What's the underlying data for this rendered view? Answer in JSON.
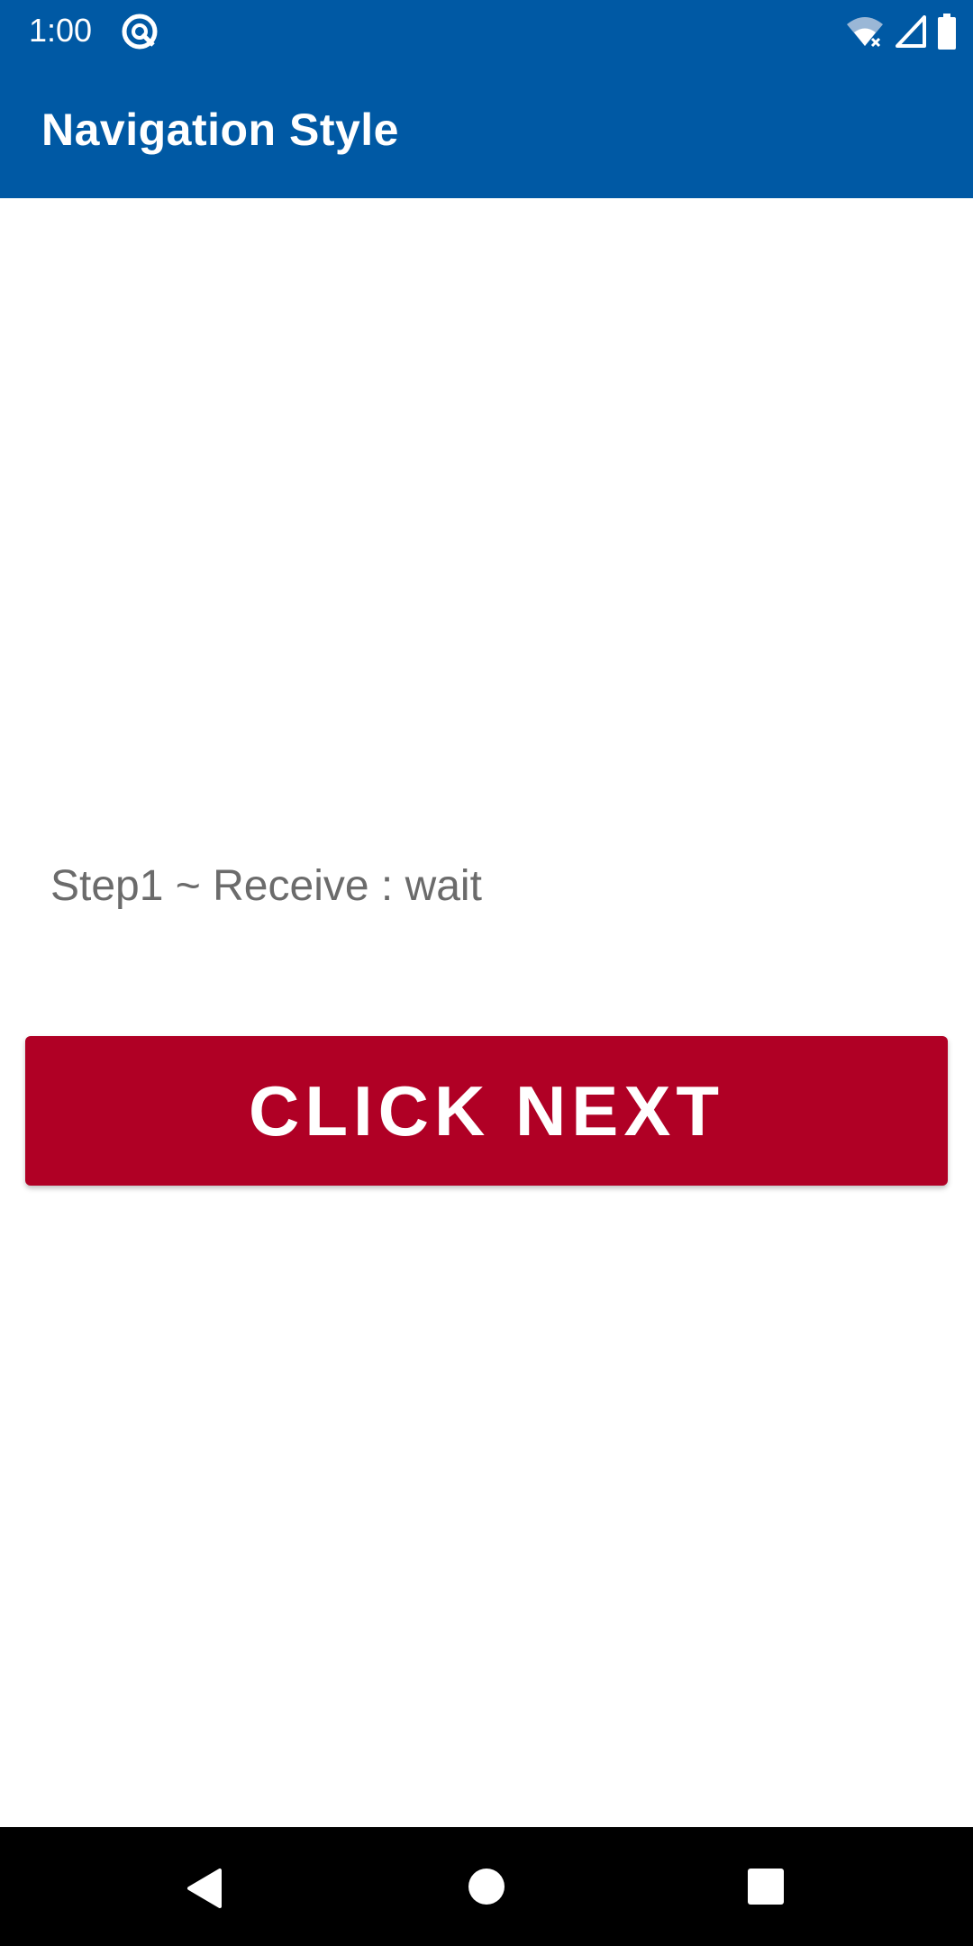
{
  "status_bar": {
    "time": "1:00",
    "icons": [
      "app-notification-icon",
      "wifi-icon",
      "cell-signal-icon",
      "battery-icon"
    ],
    "background": "#0059a4"
  },
  "app_bar": {
    "title": "Navigation Style",
    "background": "#0059a4"
  },
  "main": {
    "step_status": "Step1 ~ Receive : wait",
    "next_button_label": "CLICK NEXT",
    "next_button_color": "#b00025"
  },
  "nav_bar": {
    "buttons": [
      "back-icon",
      "home-icon",
      "recents-icon"
    ]
  }
}
